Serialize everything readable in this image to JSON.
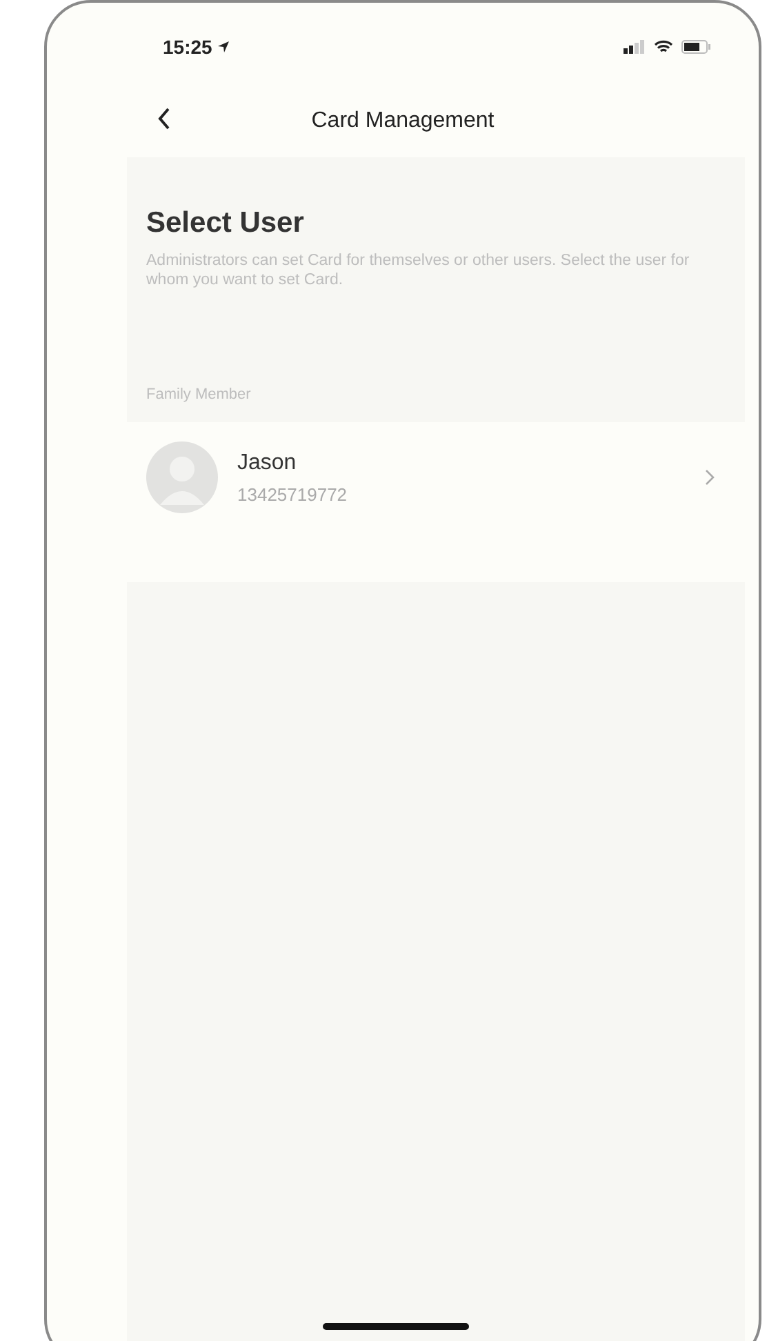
{
  "status_bar": {
    "time": "15:25"
  },
  "nav": {
    "title": "Card Management"
  },
  "header": {
    "title": "Select User",
    "description": "Administrators can set Card for themselves or other users. Select the user for whom you want to set Card."
  },
  "section_label": "Family Member",
  "users": [
    {
      "name": "Jason",
      "phone": "13425719772"
    }
  ]
}
